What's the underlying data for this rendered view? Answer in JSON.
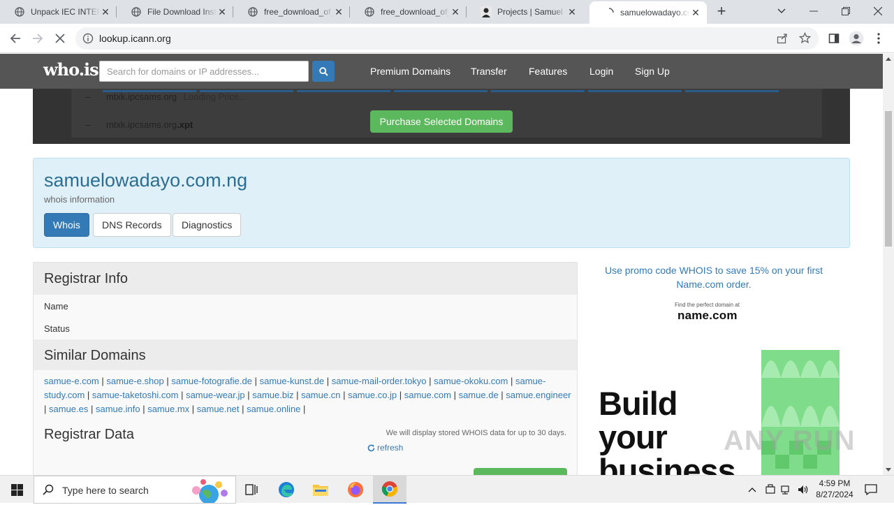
{
  "browser": {
    "tabs": [
      {
        "title": "Unpack IEC INTERN",
        "icon": "globe-icon"
      },
      {
        "title": "File Download Inst",
        "icon": "globe-icon"
      },
      {
        "title": "free_download_of_",
        "icon": "globe-icon"
      },
      {
        "title": "free_download_of_",
        "icon": "globe-icon"
      },
      {
        "title": "Projects | Samuel O",
        "icon": "profile-photo-icon"
      },
      {
        "title": "samuelowadayo.co",
        "icon": "loading-spinner-icon"
      }
    ],
    "url": "lookup.icann.org"
  },
  "site": {
    "logo": "who.is",
    "search_placeholder": "Search for domains or IP addresses...",
    "nav": [
      "Premium Domains",
      "Transfer",
      "Features",
      "Login",
      "Sign Up"
    ]
  },
  "overlay": {
    "row1_domain": "mtxk.ipcsams.org",
    "row1_note": "Loading Price...",
    "row2_domain": "mtxk.ipcsams.org",
    "row2_tld": ".xpt",
    "purchase_button": "Purchase Selected Domains"
  },
  "domain": {
    "name": "samuelowadayo.com.ng",
    "subtitle": "whois information",
    "tabs": [
      "Whois",
      "DNS Records",
      "Diagnostics"
    ]
  },
  "registrar_info": {
    "heading": "Registrar Info",
    "fields": [
      "Name",
      "Status"
    ]
  },
  "similar_domains": {
    "heading": "Similar Domains",
    "items": [
      "samue-e.com",
      "samue-e.shop",
      "samue-fotografie.de",
      "samue-kunst.de",
      "samue-mail-order.tokyo",
      "samue-okoku.com",
      "samue-study.com",
      "samue-taketoshi.com",
      "samue-wear.jp",
      "samue.biz",
      "samue.cn",
      "samue.co.jp",
      "samue.com",
      "samue.de",
      "samue.engineer",
      "samue.es",
      "samue.info",
      "samue.mx",
      "samue.net",
      "samue.online"
    ]
  },
  "registrar_data": {
    "heading": "Registrar Data",
    "note": "We will display stored WHOIS data for up to 30 days.",
    "refresh": "refresh"
  },
  "sidebar": {
    "promo": "Use promo code WHOIS to save 15% on your first Name.com order.",
    "tagline": "Find the perfect domain at",
    "brand": "name.com",
    "ad_headline": [
      "Build",
      "your",
      "business"
    ],
    "watermark": "ANY RUN"
  },
  "taskbar": {
    "search_placeholder": "Type here to search",
    "time": "4:59 PM",
    "date": "8/27/2024"
  }
}
